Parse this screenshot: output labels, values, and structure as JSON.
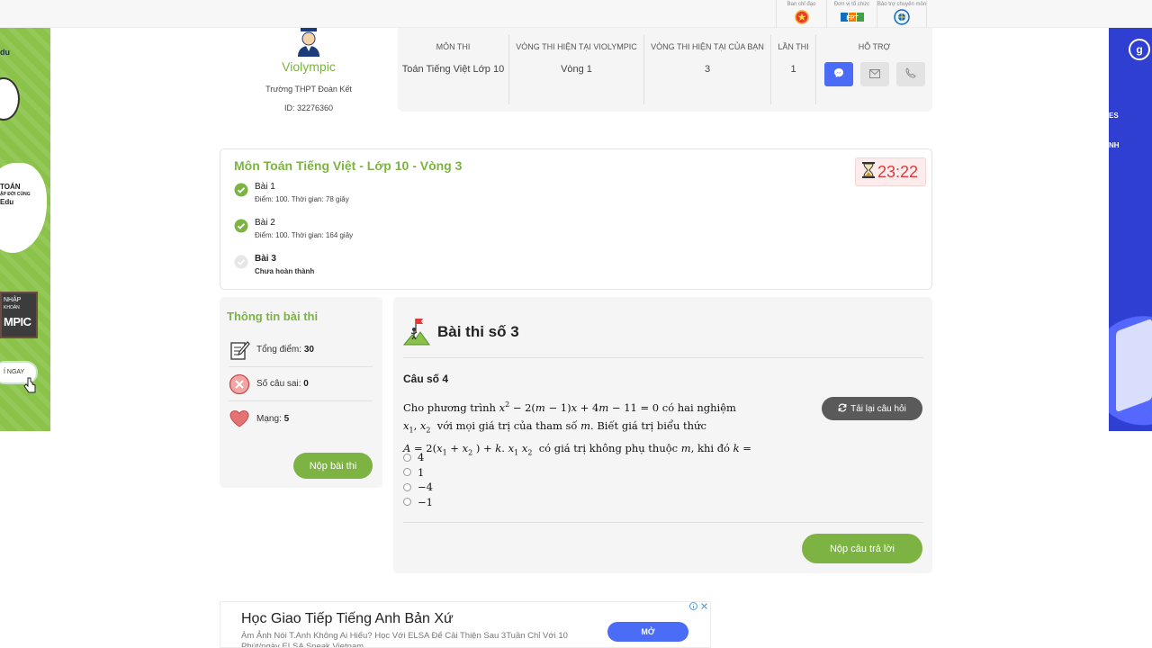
{
  "sponsors": [
    {
      "label": "Ban chỉ đạo",
      "icon": "vn-emblem-icon"
    },
    {
      "label": "Đơn vị tổ chức",
      "logo": "FPT"
    },
    {
      "label": "Bảo trợ chuyên môn",
      "icon": "ministry-logo-icon"
    }
  ],
  "ad_left": {
    "line1": "du",
    "line2": "TOÁN",
    "line2_sub": "ẬP ĐỜI CÙNG",
    "line3": "Edu",
    "board_top": "NHẬP",
    "board_sub": "KHOẢN",
    "board_main": "MPIC",
    "button": "Í NGAY"
  },
  "ad_right": {
    "logo": "g",
    "line1": "ES",
    "line2": "NH"
  },
  "user": {
    "brand": "Violympic",
    "school": "Trường THPT Đoàn Kết",
    "id": "ID: 32276360"
  },
  "info_table": {
    "headers": {
      "subject": "MÔN THI",
      "round_system": "VÒNG THI HIỆN TẠI VIOLYMPIC",
      "round_user": "VÒNG THI HIỆN TẠI CỦA BẠN",
      "attempt": "LẦN THI",
      "support": "HỖ TRỢ"
    },
    "values": {
      "subject": "Toán Tiếng Việt Lớp 10",
      "round_system": "Vòng 1",
      "round_user": "3",
      "attempt": "1"
    }
  },
  "progress": {
    "title": "Môn Toán Tiếng Việt - Lớp 10 - Vòng 3",
    "timer": "23:22",
    "lessons": [
      {
        "name": "Bài 1",
        "detail": "Điểm: 100. Thời gian: 78 giây",
        "done": true
      },
      {
        "name": "Bài 2",
        "detail": "Điểm: 100. Thời gian: 164 giây",
        "done": true
      },
      {
        "name": "Bài 3",
        "detail": "Chưa hoàn thành",
        "done": false
      }
    ]
  },
  "stats": {
    "title": "Thông tin bài thi",
    "total_label": "Tổng điểm: ",
    "total_value": "30",
    "wrong_label": "Số câu sai: ",
    "wrong_value": "0",
    "lives_label": "Mạng: ",
    "lives_value": "5",
    "submit_label": "Nộp bài thi"
  },
  "question": {
    "header": "Bài thi số 3",
    "number": "Câu số 4",
    "reload_label": "Tải lại câu hỏi",
    "options": [
      "4",
      "1",
      "−4",
      "−1"
    ],
    "submit_label": "Nộp câu trả lời"
  },
  "bottom_ad": {
    "title": "Học Giao Tiếp Tiếng Anh Bản Xứ",
    "text": "Ám Ảnh Nói T.Anh Không Ai Hiểu? Học Với ELSA Để Cải Thiện Sau 3Tuần Chỉ Với 10 Phút/ngày ELSA Speak Vietnam",
    "button": "MỞ"
  },
  "colors": {
    "accent_green": "#7cb342",
    "timer_red": "#d93c3c",
    "messenger_blue": "#4a6cf7"
  }
}
